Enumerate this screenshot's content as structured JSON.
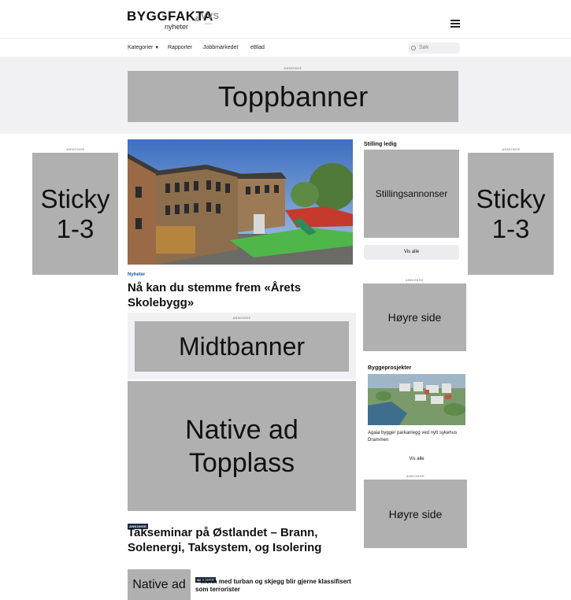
{
  "header": {
    "logo_main": "BYGGFAKTA",
    "logo_sub": "nyheter",
    "logo_sep": "&",
    "logo_partner": "VVS",
    "logo_partner_sub": "aktuelt"
  },
  "nav": {
    "items": [
      "Kategorier",
      "Rapporter",
      "Jobbmarkedet",
      "eBlad"
    ],
    "search_placeholder": "Søk"
  },
  "ad_label": "ANNONSE",
  "ads": {
    "top_banner": "Toppbanner",
    "sticky_left": "Sticky 1-3",
    "sticky_right": "Sticky 1-3",
    "mid_banner": "Midtbanner",
    "native_top": "Native ad Topplass",
    "native_small": "Native ad",
    "right_side_1": "Høyre side",
    "right_side_2": "Høyre side"
  },
  "main": {
    "category": "Nyheter",
    "headline": "Nå kan du stemme frem «Årets Skolebygg»",
    "tak_badge": "ANNONSE",
    "tak_headline": "Takseminar på Østlandet – Brann, Solenergi, Taksystem, og Isolering",
    "small_badge": "ANNONSE",
    "small_headline": "– Menn med turban og skjegg blir gjerne klassifisert som terrorister"
  },
  "sidebar": {
    "stilling_title": "Stilling ledig",
    "stilling_box": "Stillingsannonser",
    "vis_alle": "Vis alle",
    "bygg_title": "Byggeprosjekter",
    "bygg_caption": "Agaia bygger parkanlegg ved nytt sykehus Drammen",
    "bygg_vis_alle": "Vis alle"
  },
  "colors": {
    "ad_gray": "#b0b0b0",
    "band_bg": "#f1f1f3",
    "category_blue": "#1d5da8",
    "badge_navy": "#1f2a44"
  }
}
